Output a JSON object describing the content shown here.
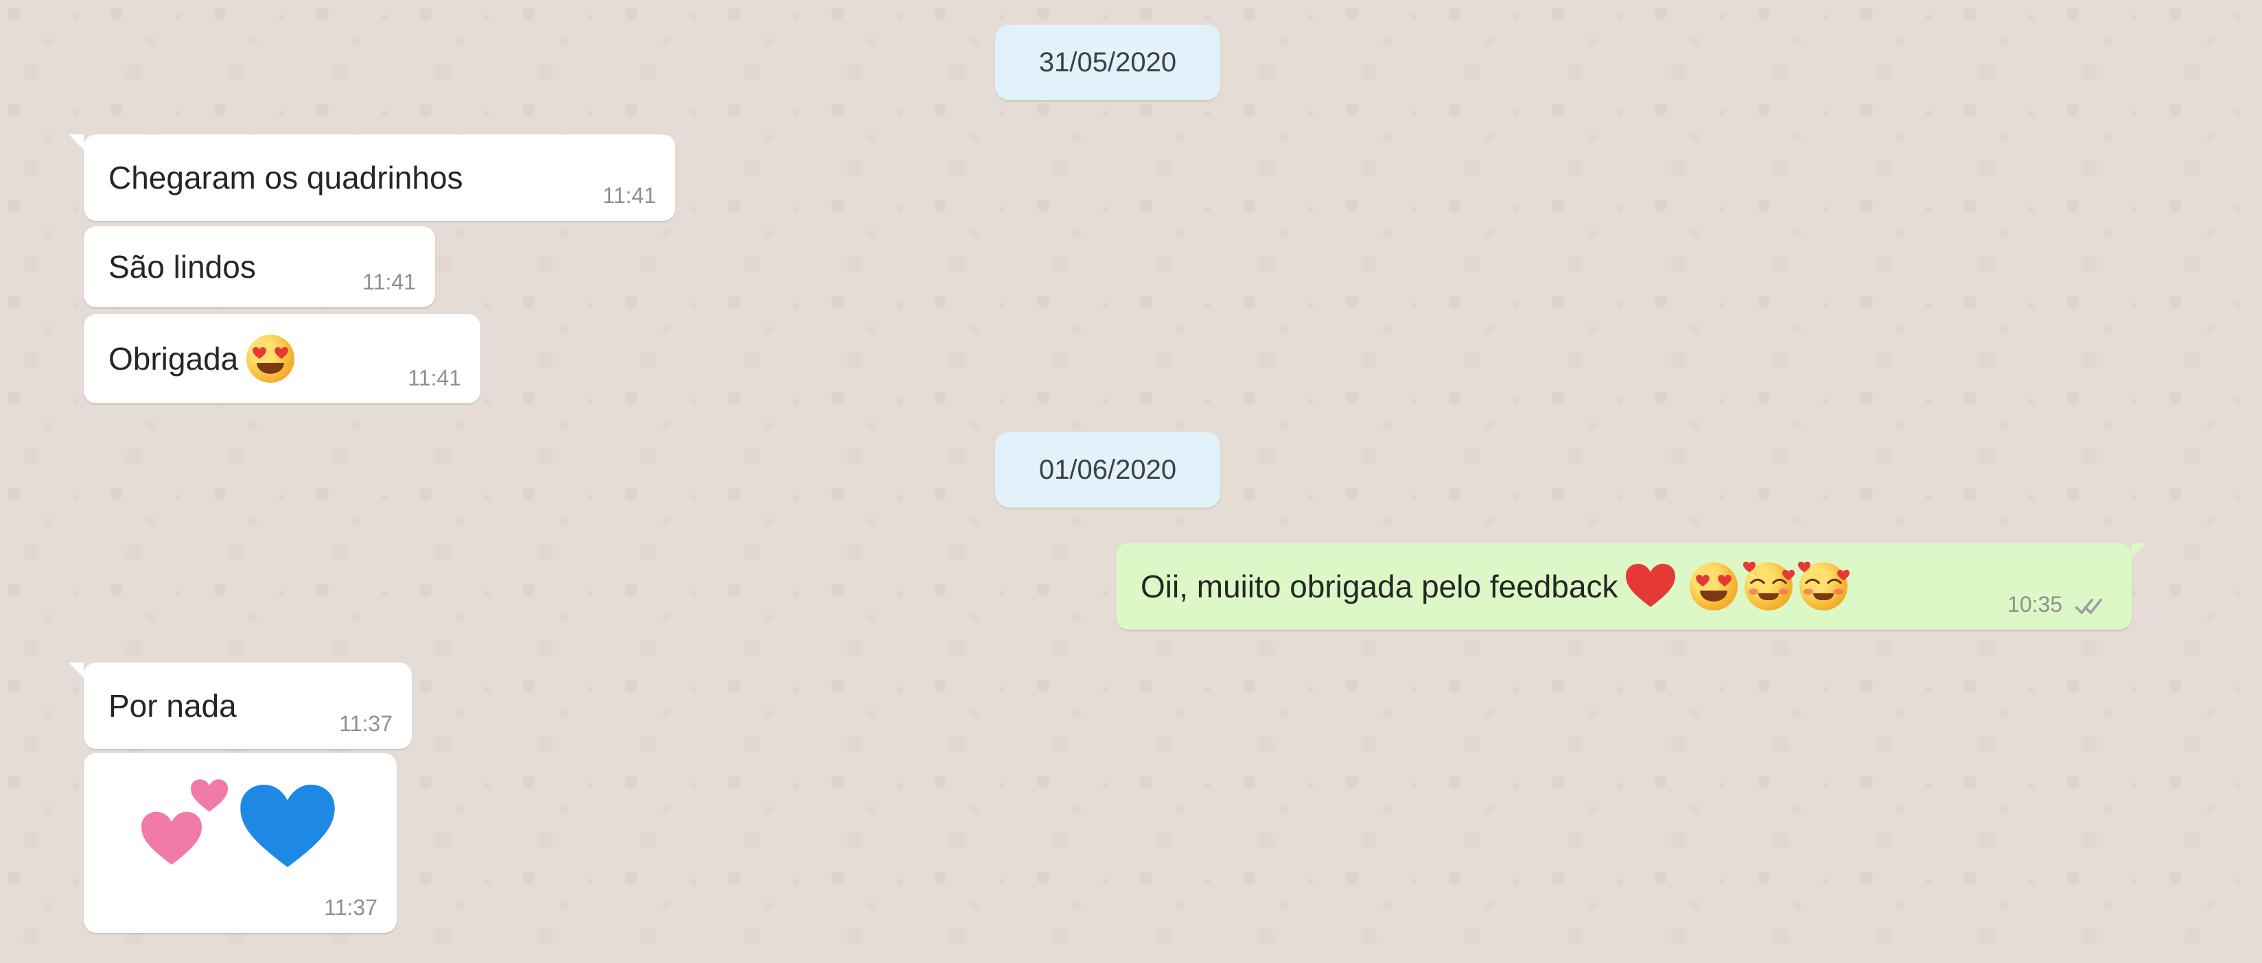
{
  "chat": {
    "groups": [
      {
        "date": "31/05/2020",
        "messages": [
          {
            "direction": "incoming",
            "text": "Chegaram os quadrinhos",
            "time": "11:41",
            "emojis": []
          },
          {
            "direction": "incoming",
            "text": "São lindos",
            "time": "11:41",
            "emojis": []
          },
          {
            "direction": "incoming",
            "text": "Obrigada",
            "time": "11:41",
            "emojis": [
              "heart-eyes-face"
            ]
          }
        ]
      },
      {
        "date": "01/06/2020",
        "messages": [
          {
            "direction": "outgoing",
            "text": "Oii, muiito obrigada pelo feedback",
            "time": "10:35",
            "emojis": [
              "red-heart",
              "heart-eyes-face",
              "smiling-face-with-hearts",
              "smiling-face-with-hearts"
            ],
            "status": "double-check"
          },
          {
            "direction": "incoming",
            "text": "Por nada",
            "time": "11:37",
            "emojis": []
          },
          {
            "direction": "incoming",
            "text": "",
            "time": "11:37",
            "emojis": [
              "two-hearts",
              "blue-heart"
            ]
          }
        ]
      }
    ]
  },
  "colors": {
    "wallpaper": "#e5ddd5",
    "date_chip": "#e1f2fb",
    "incoming_bubble": "#ffffff",
    "outgoing_bubble": "#dcf8c6",
    "read_receipt": "#9aa0a6"
  }
}
